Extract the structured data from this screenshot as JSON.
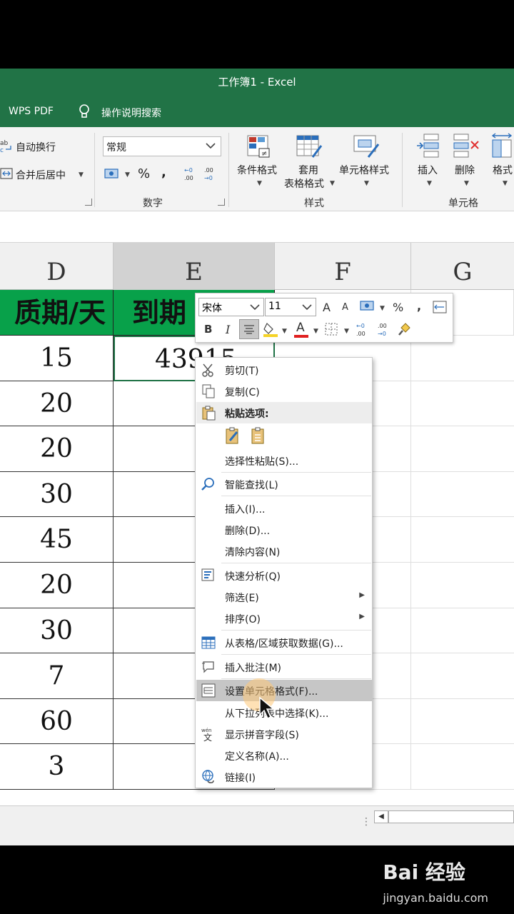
{
  "window": {
    "title": "工作簿1  -  Excel"
  },
  "tabs": {
    "wps_pdf": "WPS PDF",
    "tell_me": "操作说明搜索",
    "tell_me_icon": "lightbulb-icon"
  },
  "ribbon": {
    "alignment": {
      "wrap_text": "自动换行",
      "merge_center": "合并后居中"
    },
    "number": {
      "format_value": "常规",
      "percent": "%",
      "comma": ",",
      "group_label": "数字"
    },
    "styles": {
      "conditional": "条件格式",
      "table_top": "套用",
      "table_bottom": "表格格式",
      "cell_styles": "单元格样式",
      "group_label": "样式"
    },
    "cells": {
      "insert": "插入",
      "delete": "删除",
      "format": "格式",
      "group_label": "单元格"
    }
  },
  "columns": [
    "D",
    "E",
    "F",
    "G"
  ],
  "sheet": {
    "header_d": "质期/天",
    "header_e": "到期",
    "d_values": [
      "15",
      "20",
      "20",
      "30",
      "45",
      "20",
      "30",
      "7",
      "60",
      "3"
    ],
    "e_first": "43915"
  },
  "minibar": {
    "font": "宋体",
    "size": "11",
    "grow": "A",
    "shrink": "A",
    "percent": "%",
    "comma": ",",
    "bold": "B",
    "italic": "I",
    "font_color_letter": "A",
    "fill_color": "#f5d327",
    "font_color": "#e02020"
  },
  "context_menu": {
    "cut": "剪切(T)",
    "copy": "复制(C)",
    "paste_options": "粘贴选项:",
    "paste_special": "选择性粘贴(S)...",
    "smart_lookup": "智能查找(L)",
    "insert": "插入(I)...",
    "delete": "删除(D)...",
    "clear": "清除内容(N)",
    "quick_analysis": "快速分析(Q)",
    "filter": "筛选(E)",
    "sort": "排序(O)",
    "get_data": "从表格/区域获取数据(G)...",
    "insert_comment": "插入批注(M)",
    "format_cells": "设置单元格格式(F)...",
    "pick_list": "从下拉列表中选择(K)...",
    "phonetic": "显示拼音字段(S)",
    "define_name": "定义名称(A)...",
    "link": "链接(I)"
  },
  "watermark": {
    "brand": "Bai  经验",
    "url": "jingyan.baidu.com"
  },
  "colors": {
    "excel_green": "#217346",
    "header_green": "#08a14a"
  }
}
